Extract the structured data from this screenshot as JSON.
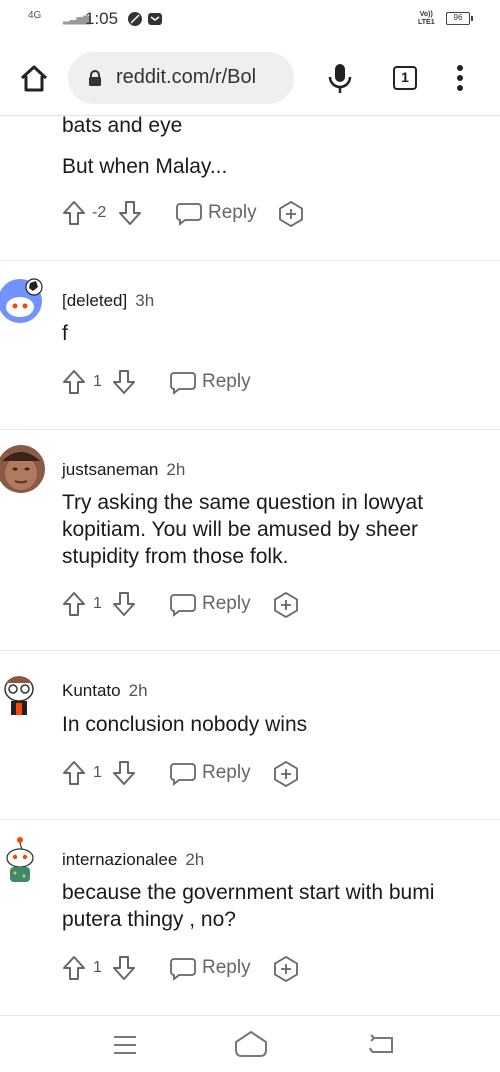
{
  "status_bar": {
    "network": "4G",
    "time": "1:05",
    "volte": "Vo))\nLTE1",
    "battery": "96"
  },
  "browser": {
    "url": "reddit.com/r/Bol",
    "tab_count": "1"
  },
  "comments": [
    {
      "author": "",
      "time": "",
      "body_lines": [
        "bats and eye",
        "But when Malay..."
      ],
      "score": "-2",
      "reply_label": "Reply"
    },
    {
      "author": "[deleted]",
      "time": "3h",
      "body": "f",
      "score": "1",
      "reply_label": "Reply"
    },
    {
      "author": "justsaneman",
      "time": "2h",
      "body": "Try asking the same question in lowyat kopitiam. You will be amused by sheer stupidity from those folk.",
      "score": "1",
      "reply_label": "Reply"
    },
    {
      "author": "Kuntato",
      "time": "2h",
      "body": "In conclusion nobody wins",
      "score": "1",
      "reply_label": "Reply"
    },
    {
      "author": "internazionalee",
      "time": "2h",
      "body": "because the government start with bumi putera thingy , no?",
      "score": "1",
      "reply_label": "Reply"
    }
  ],
  "icons": {
    "home": "home-icon",
    "lock": "lock-icon",
    "mic": "microphone-icon",
    "more": "more-vert-icon",
    "upvote": "upvote-arrow-icon",
    "downvote": "downvote-arrow-icon",
    "reply": "speech-bubble-icon",
    "award": "award-plus-icon",
    "nav_menu": "menu-icon",
    "nav_home": "home-outline-icon",
    "nav_back": "back-icon"
  },
  "colors": {
    "accent_blue": "#5e7ce2",
    "text": "#1a1a1b",
    "muted": "#666666"
  }
}
